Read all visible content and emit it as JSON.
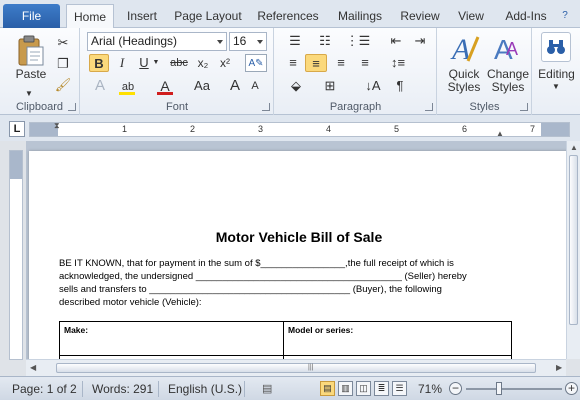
{
  "tabs": {
    "file": "File",
    "home": "Home",
    "insert": "Insert",
    "page_layout": "Page Layout",
    "references": "References",
    "mailings": "Mailings",
    "review": "Review",
    "view": "View",
    "addins": "Add-Ins"
  },
  "ribbon": {
    "clipboard": {
      "label": "Clipboard",
      "paste": "Paste"
    },
    "font": {
      "label": "Font",
      "font_name": "Arial (Headings)",
      "font_size": "16",
      "bold": "B",
      "italic": "I",
      "underline": "U",
      "strikethrough": "abc",
      "subscript": "x₂",
      "superscript": "x²",
      "change_case": "Aa",
      "grow": "A",
      "shrink": "A"
    },
    "paragraph": {
      "label": "Paragraph",
      "pilcrow": "¶"
    },
    "styles": {
      "label": "Styles",
      "quick_styles": "Quick Styles",
      "change_styles": "Change Styles"
    },
    "editing": {
      "label": "Editing"
    }
  },
  "ruler": {
    "corner": "L",
    "numbers": [
      "1",
      "2",
      "3",
      "4",
      "5",
      "6",
      "7"
    ]
  },
  "document": {
    "title": "Motor Vehicle  Bill of Sale",
    "paragraph_lines": [
      "BE IT KNOWN,  that for payment in the sum of $________________,the full receipt of which  is",
      "acknowledged, the undersigned _______________________________________ (Seller) hereby",
      "sells  and transfers to ______________________________________ (Buyer), the following",
      "described motor vehicle  (Vehicle):"
    ],
    "table": {
      "rows": [
        [
          "Make:",
          "Model or series:"
        ],
        [
          "",
          ""
        ]
      ]
    }
  },
  "status": {
    "page": "Page: 1 of 2",
    "words": "Words: 291",
    "language": "English (U.S.)",
    "zoom": "71%"
  }
}
